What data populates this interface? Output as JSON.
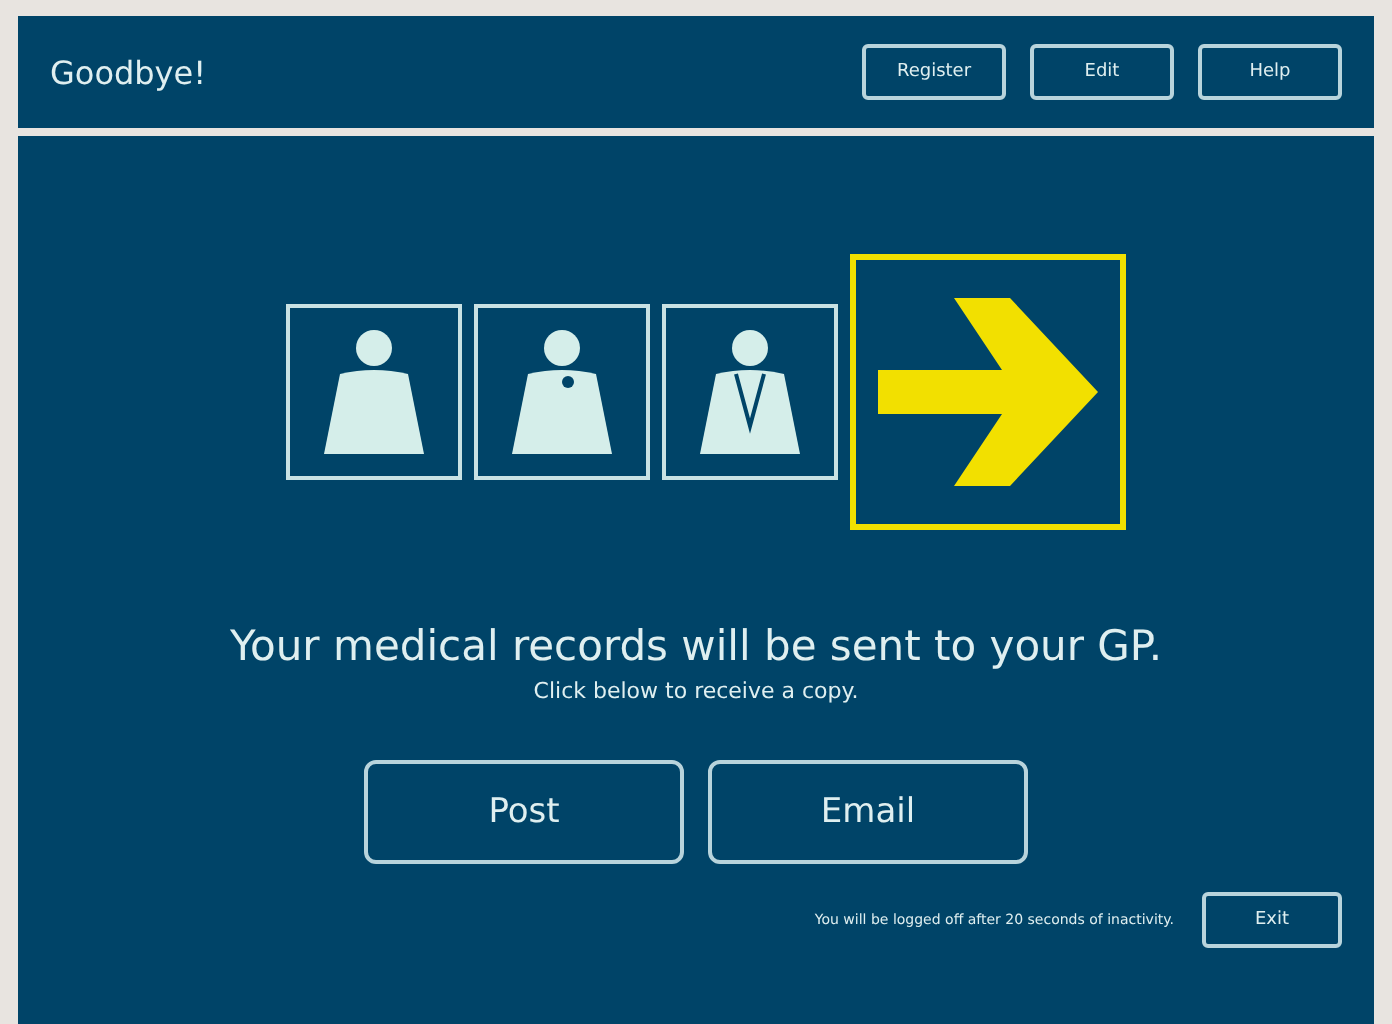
{
  "header": {
    "title": "Goodbye!",
    "buttons": [
      "Register",
      "Edit",
      "Help"
    ]
  },
  "steps": [
    {
      "kind": "patient",
      "selected": false
    },
    {
      "kind": "doctor",
      "selected": false
    },
    {
      "kind": "clinician",
      "selected": false
    },
    {
      "kind": "arrow",
      "selected": true
    }
  ],
  "message": {
    "heading": "Your medical records will be sent to your GP.",
    "subtext": "Click below to receive a copy."
  },
  "options": [
    "Post",
    "Email"
  ],
  "footer": {
    "notice": "You will be logged off after 20 seconds of inactivity.",
    "button": "Exit"
  }
}
